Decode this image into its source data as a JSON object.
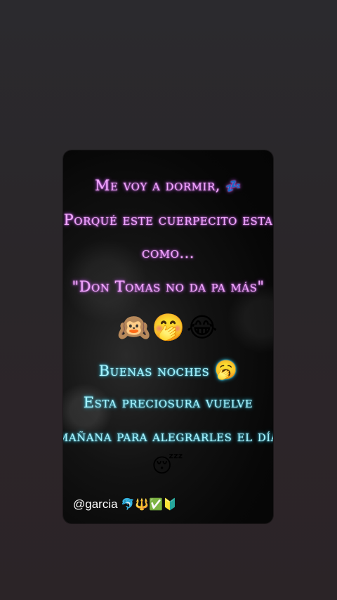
{
  "story": {
    "line1": "Me voy a dormir,",
    "line1_emoji": "💤",
    "line2": "Porqué este cuerpecito esta",
    "line3": "como...",
    "line4": "\"Don Tomas no da pa más\"",
    "emoji_row": "🙉🤭😂",
    "line5": "Buenas noches",
    "line5_emoji": "🥱",
    "line6": "Esta preciosura vuelve",
    "line7": "mañana para alegrarles el día",
    "sleep_emoji": "😴",
    "handle": "@garcia",
    "handle_icons": "🐬🔱✅🔰"
  },
  "colors": {
    "pink_text": "#f2a8ff",
    "cyan_text": "#a9f4ff",
    "card_bg": "#0a0a0a",
    "page_bg": "#2b2729"
  }
}
